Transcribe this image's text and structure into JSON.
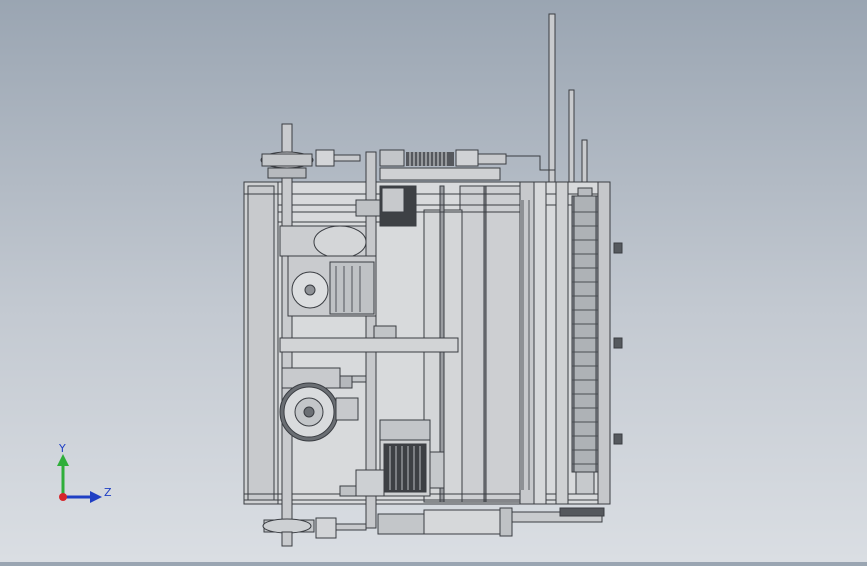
{
  "triad": {
    "y_label": "Y",
    "z_label": "Z",
    "y_color": "#2fae3a",
    "z_color": "#1f3fc4",
    "origin_color": "#d6262b"
  },
  "model": {
    "frame_color": "#d2d4d6",
    "edge_color": "#3a3d42",
    "shadow_color": "#a9acb0",
    "dark_color": "#6c7075"
  }
}
